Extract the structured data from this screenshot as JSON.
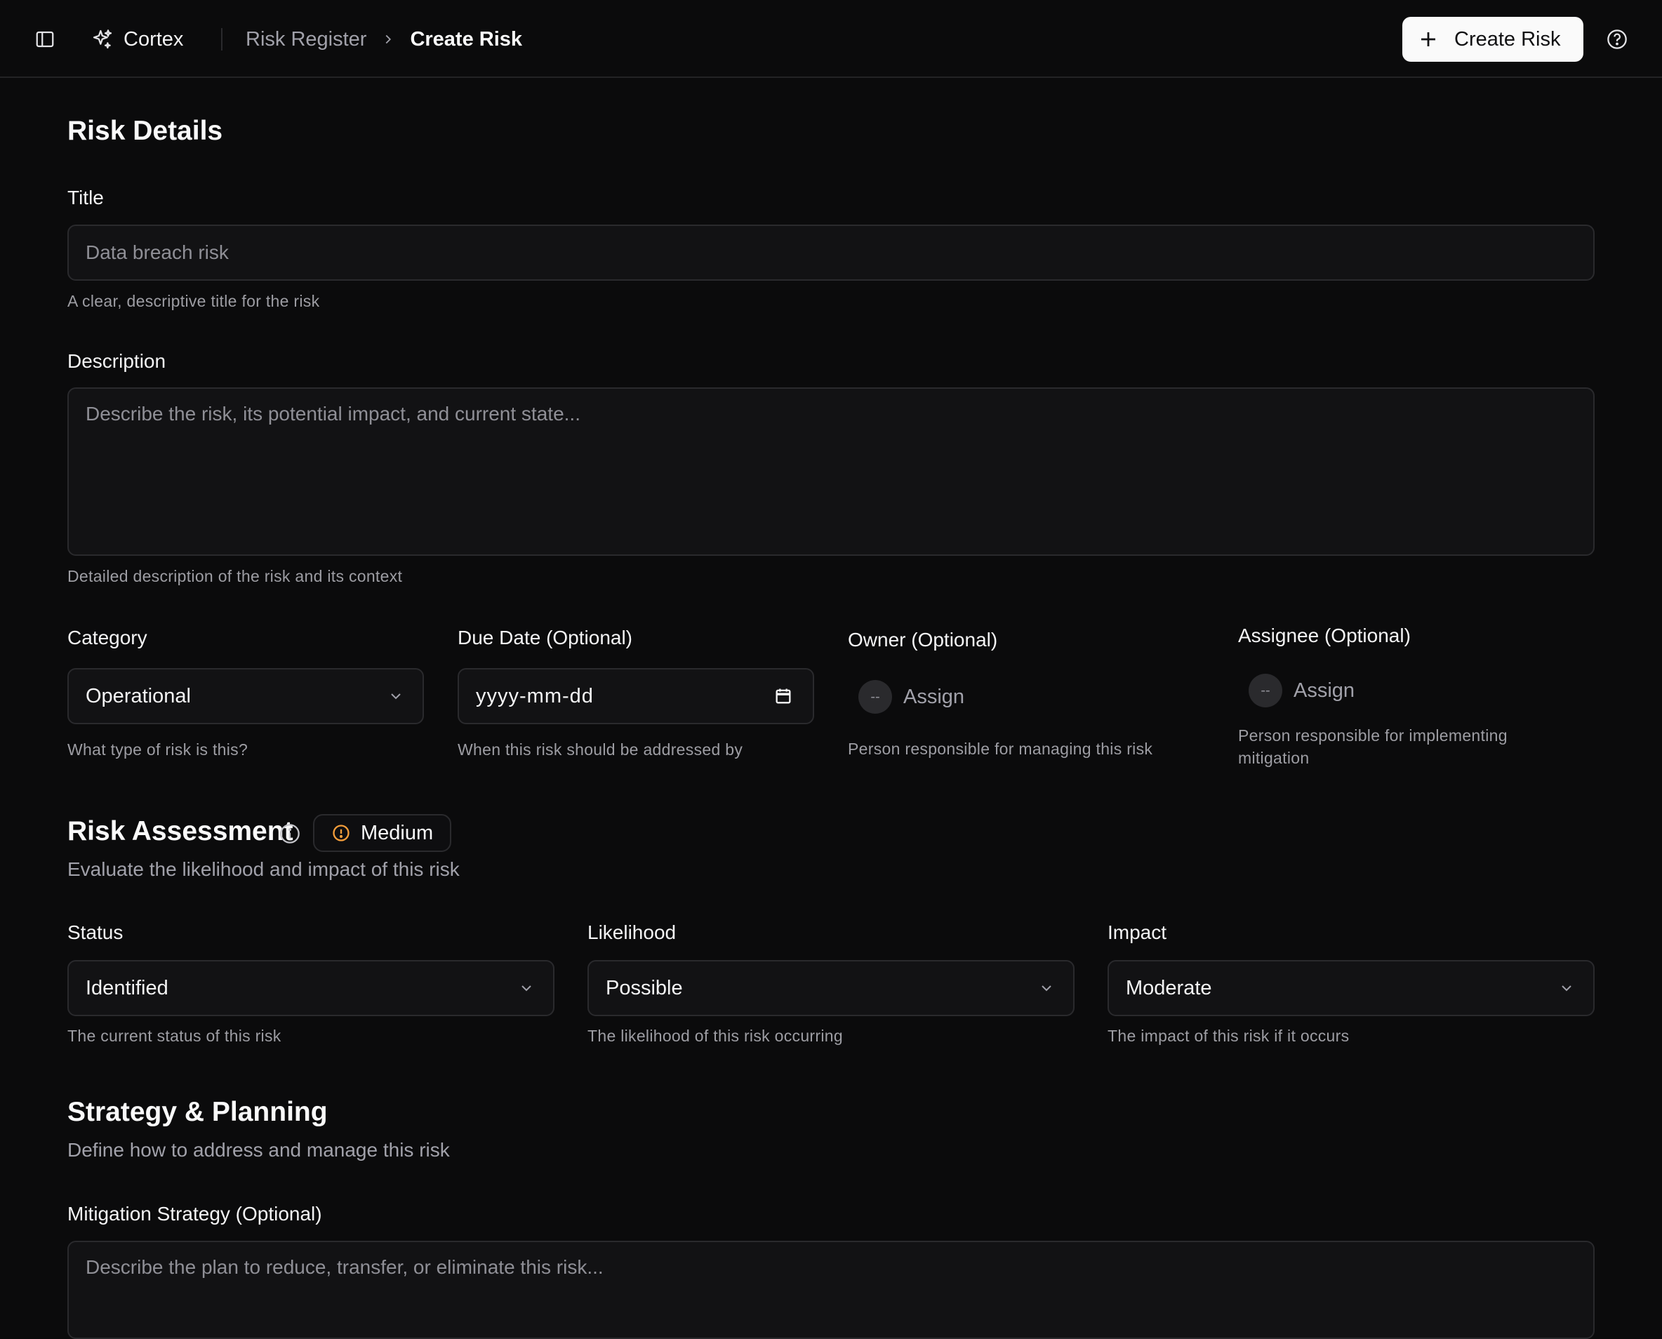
{
  "header": {
    "brand": "Cortex",
    "breadcrumb": [
      "Risk Register",
      "Create Risk"
    ],
    "create_button": "Create Risk"
  },
  "risk_details": {
    "heading": "Risk Details",
    "title": {
      "label": "Title",
      "placeholder": "Data breach risk",
      "hint": "A clear, descriptive title for the risk"
    },
    "description": {
      "label": "Description",
      "placeholder": "Describe the risk, its potential impact, and current state...",
      "hint": "Detailed description of the risk and its context"
    },
    "category": {
      "label": "Category",
      "value": "Operational",
      "hint": "What type of risk is this?"
    },
    "due_date": {
      "label": "Due Date (Optional)",
      "placeholder": "yyyy-mm-dd",
      "hint": "When this risk should be addressed by"
    },
    "owner": {
      "label": "Owner (Optional)",
      "avatar": "--",
      "action": "Assign",
      "hint": "Person responsible for managing this risk"
    },
    "assignee": {
      "label": "Assignee (Optional)",
      "avatar": "--",
      "action": "Assign",
      "hint": "Person responsible for implementing mitigation"
    }
  },
  "risk_assessment": {
    "heading": "Risk Assessment",
    "badge": "Medium",
    "badge_color": "#f59e3b",
    "subtitle": "Evaluate the likelihood and impact of this risk",
    "status": {
      "label": "Status",
      "value": "Identified",
      "hint": "The current status of this risk"
    },
    "likelihood": {
      "label": "Likelihood",
      "value": "Possible",
      "hint": "The likelihood of this risk occurring"
    },
    "impact": {
      "label": "Impact",
      "value": "Moderate",
      "hint": "The impact of this risk if it occurs"
    }
  },
  "strategy": {
    "heading": "Strategy & Planning",
    "subtitle": "Define how to address and manage this risk",
    "mitigation": {
      "label": "Mitigation Strategy (Optional)",
      "placeholder": "Describe the plan to reduce, transfer, or eliminate this risk..."
    }
  },
  "icons": [
    "sidebar-toggle-icon",
    "sparkles-icon",
    "chevron-right-icon",
    "plus-icon",
    "help-circle-icon",
    "chevron-down-icon",
    "calendar-icon",
    "info-icon",
    "alert-circle-icon"
  ]
}
